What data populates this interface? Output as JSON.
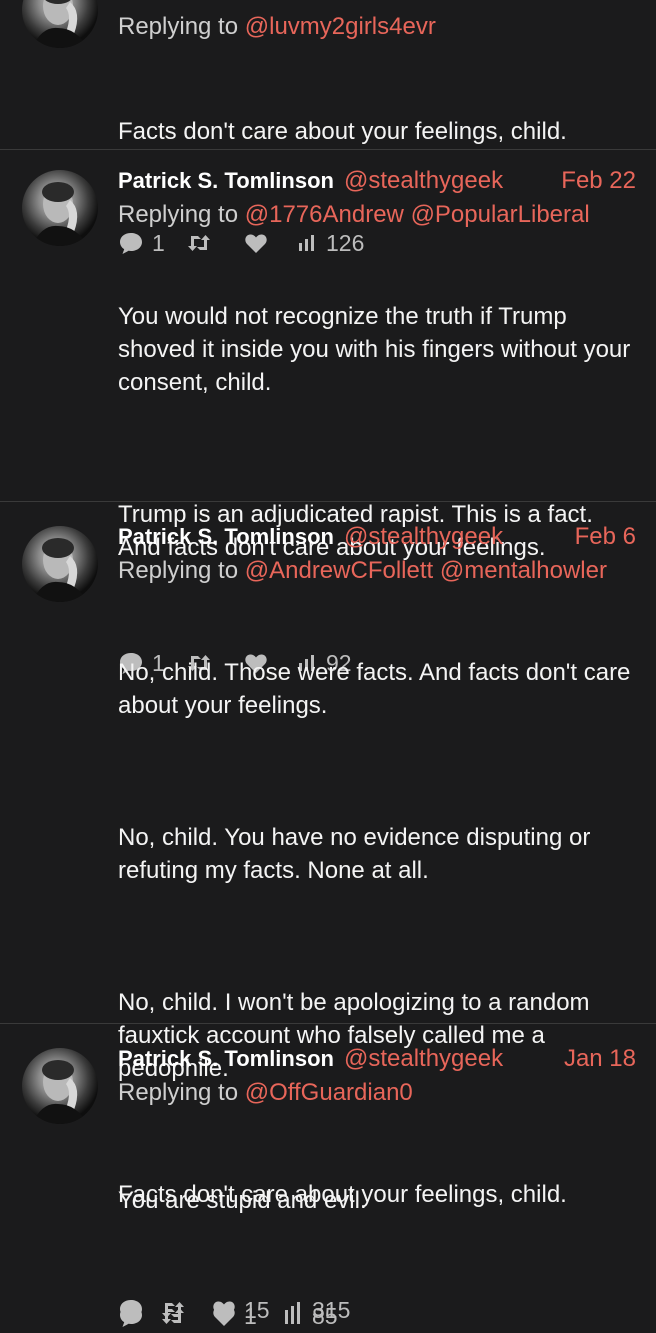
{
  "tweets": [
    {
      "name": "",
      "handle": "",
      "date": "",
      "replying_prefix": "Replying to",
      "mentions": [
        "@luvmy2girls4evr"
      ],
      "body": [
        "Facts don't care about your feelings, child."
      ],
      "replies": "1",
      "retweets": "",
      "likes": "",
      "views": "126"
    },
    {
      "name": "Patrick S. Tomlinson",
      "handle": "@stealthygeek",
      "date": "Feb 22",
      "replying_prefix": "Replying to",
      "mentions": [
        "@1776Andrew",
        "@PopularLiberal"
      ],
      "body": [
        "You would not recognize the truth if Trump shoved it inside you with his fingers without your consent, child.",
        "Trump is an adjudicated rapist. This is a fact. And facts don't care about your feelings."
      ],
      "replies": "1",
      "retweets": "",
      "likes": "",
      "views": "92"
    },
    {
      "name": "Patrick S. Tomlinson",
      "handle": "@stealthygeek",
      "date": "Feb 6",
      "replying_prefix": "Replying to",
      "mentions": [
        "@AndrewCFollett",
        "@mentalhowler"
      ],
      "body": [
        "No, child. Those were facts. And facts don't care about your feelings.",
        "No, child. You have no evidence disputing or refuting my facts. None at all.",
        "No, child. I won't be apologizing to a random fauxtick account who falsely called me a pedophile.",
        "You are stupid and evil."
      ],
      "replies": "",
      "retweets": "",
      "likes": "1",
      "views": "85"
    },
    {
      "name": "Patrick S. Tomlinson",
      "handle": "@stealthygeek",
      "date": "Jan 18",
      "replying_prefix": "Replying to",
      "mentions": [
        "@OffGuardian0"
      ],
      "body": [
        "Facts don't care about your feelings, child."
      ],
      "replies": "",
      "retweets": "",
      "likes": "15",
      "views": "315"
    }
  ],
  "icons": {
    "reply": "comment-bubble-icon",
    "retweet": "retweet-icon",
    "like": "heart-icon",
    "views": "bar-chart-icon"
  },
  "colors": {
    "background": "#1b1b1c",
    "accent": "#e8665a",
    "text": "#f4f4f4",
    "muted": "#bdbdbd",
    "divider": "#3a3a3a"
  }
}
